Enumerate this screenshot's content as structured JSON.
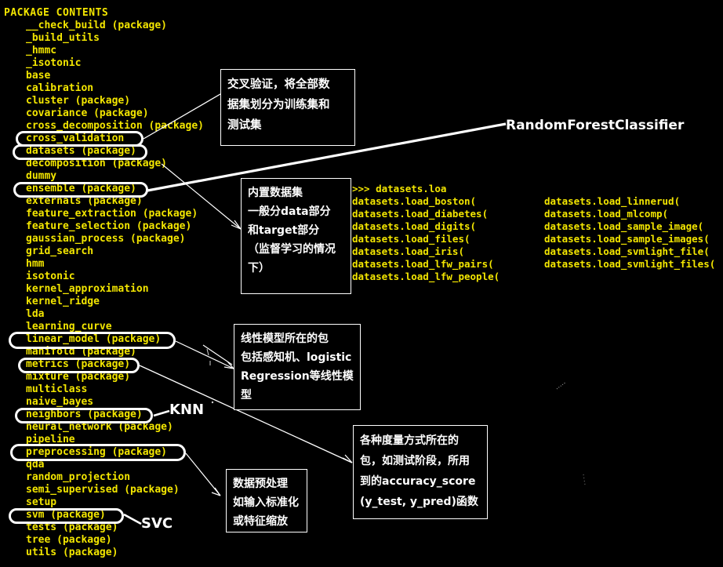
{
  "terminal": {
    "title": "PACKAGE CONTENTS",
    "text_color": "#f3e600",
    "background_color": "#000000",
    "packages": [
      "__check_build (package)",
      "_build_utils",
      "_hmmc",
      "_isotonic",
      "base",
      "calibration",
      "cluster (package)",
      "covariance (package)",
      "cross_decomposition (package)",
      "cross_validation",
      "datasets (package)",
      "decomposition (package)",
      "dummy",
      "ensemble (package)",
      "externals (package)",
      "feature_extraction (package)",
      "feature_selection (package)",
      "gaussian_process (package)",
      "grid_search",
      "hmm",
      "isotonic",
      "kernel_approximation",
      "kernel_ridge",
      "lda",
      "learning_curve",
      "linear_model (package)",
      "manifold (package)",
      "metrics (package)",
      "mixture (package)",
      "multiclass",
      "naive_bayes",
      "neighbors (package)",
      "neural_network (package)",
      "pipeline",
      "preprocessing (package)",
      "qda",
      "random_projection",
      "semi_supervised (package)",
      "setup",
      "svm (package)",
      "tests (package)",
      "tree (package)",
      "utils (package)"
    ]
  },
  "console": {
    "prompt_line": ">>> datasets.loa",
    "left_column": [
      "datasets.load_boston(",
      "datasets.load_diabetes(",
      "datasets.load_digits(",
      "datasets.load_files(",
      "datasets.load_iris(",
      "datasets.load_lfw_pairs(",
      "datasets.load_lfw_people("
    ],
    "right_column": [
      "datasets.load_linnerud(",
      "datasets.load_mlcomp(",
      "datasets.load_sample_image(",
      "datasets.load_sample_images(",
      "datasets.load_svmlight_file(",
      "datasets.load_svmlight_files("
    ]
  },
  "highlights": [
    {
      "id": "hl-cross-validation",
      "target": "cross_validation"
    },
    {
      "id": "hl-datasets",
      "target": "datasets (package)"
    },
    {
      "id": "hl-ensemble",
      "target": "ensemble (package)"
    },
    {
      "id": "hl-linear-model",
      "target": "linear_model (package)"
    },
    {
      "id": "hl-metrics",
      "target": "metrics (package)"
    },
    {
      "id": "hl-neighbors",
      "target": "neighbors (package)"
    },
    {
      "id": "hl-preprocessing",
      "target": "preprocessing (package)"
    },
    {
      "id": "hl-svm",
      "target": "svm (package)"
    }
  ],
  "notes": {
    "cross_validation": {
      "lines": [
        "交叉验证，将全部数",
        "据集划分为训练集和",
        "测试集"
      ]
    },
    "datasets": {
      "lines": [
        "内置数据集",
        "一般分data部分",
        "和target部分",
        "（监督学习的情况",
        "下）"
      ]
    },
    "linear_model": {
      "lines": [
        "线性模型所在的包",
        "包括感知机、logistic",
        "Regression等线性模",
        "型"
      ]
    },
    "metrics": {
      "lines": [
        "各种度量方式所在的",
        "包，如测试阶段，所用",
        "到的accuracy_score",
        "(y_test, y_pred)函数"
      ]
    },
    "preprocessing": {
      "lines": [
        "数据预处理",
        "如输入标准化",
        "或特征缩放"
      ]
    }
  },
  "labels": {
    "random_forest": "RandomForestClassifier",
    "knn": "KNN",
    "svc": "SVC"
  }
}
